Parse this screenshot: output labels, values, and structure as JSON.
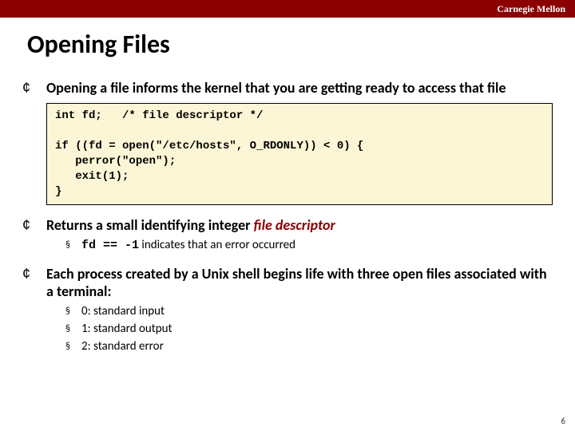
{
  "header": {
    "institution": "Carnegie Mellon"
  },
  "title": "Opening Files",
  "bullets": [
    {
      "text": "Opening a file informs the kernel that you are getting ready to access that file"
    },
    {
      "text_before": "Returns a small identifying integer ",
      "emph": "file descriptor"
    },
    {
      "text": "Each process created by a Unix shell begins life with three open files associated with a terminal:"
    }
  ],
  "code": "int fd;   /* file descriptor */\n\nif ((fd = open(\"/etc/hosts\", O_RDONLY)) < 0) {\n   perror(\"open\");\n   exit(1);\n}",
  "sub1": {
    "mono": "fd == -1",
    "rest": " indicates that an error occurred"
  },
  "sub2": [
    "0: standard input",
    "1: standard output",
    "2: standard error"
  ],
  "page_number": "6"
}
